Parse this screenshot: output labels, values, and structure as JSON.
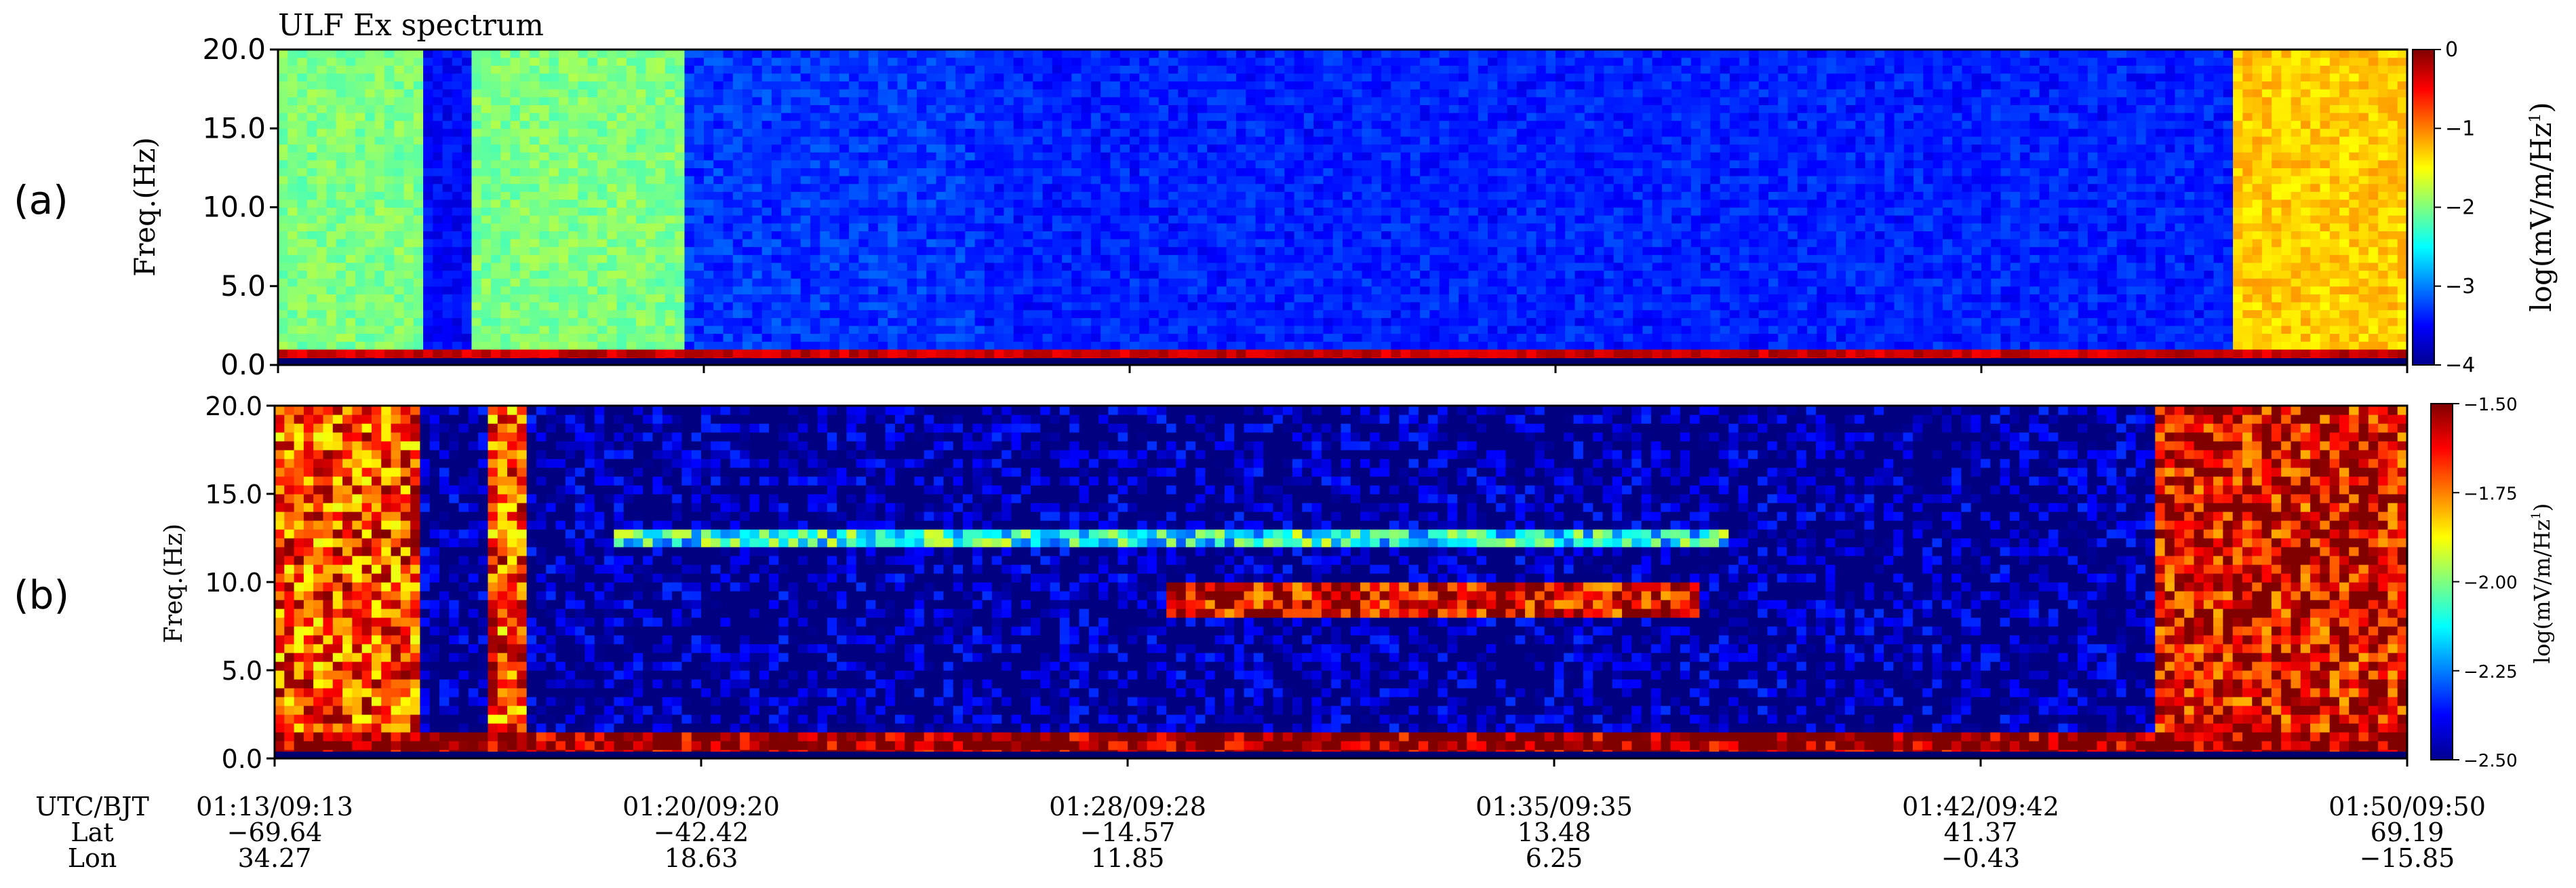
{
  "chart_data": [
    {
      "type": "heatmap",
      "panel_label": "(a)",
      "title": "ULF Ex spectrum",
      "ylabel": "Freq.(Hz)",
      "ylim": [
        0.0,
        20.0
      ],
      "yticks": [
        "0.0",
        "5.0",
        "10.0",
        "15.0",
        "20.0"
      ],
      "colorbar": {
        "label": "log(mV/m/Hz^1/2)",
        "label_main": "log(mV/m/Hz",
        "label_exp": "1",
        "label_exp_den": "2",
        "label_close": ")",
        "range": [
          -4,
          0
        ],
        "ticks": [
          "0",
          "-1",
          "-2",
          "-3",
          "-4"
        ],
        "colormap": "jet"
      },
      "features": [
        {
          "x_range": [
            0.0,
            0.07
          ],
          "f_range": [
            0,
            20
          ],
          "level": -2.0
        },
        {
          "x_range": [
            0.09,
            0.19
          ],
          "f_range": [
            0,
            20
          ],
          "level": -2.0
        },
        {
          "x_range": [
            0.19,
            0.33
          ],
          "f_range": [
            0,
            20
          ],
          "level": -3.3
        },
        {
          "x_range": [
            0.33,
            0.92
          ],
          "f_range": [
            0,
            20
          ],
          "level": -3.4
        },
        {
          "x_range": [
            0.0,
            1.0
          ],
          "f_range": [
            0,
            1.2
          ],
          "level": -0.3
        },
        {
          "x_range": [
            0.92,
            1.0
          ],
          "f_range": [
            0,
            20
          ],
          "level": -1.3
        }
      ]
    },
    {
      "type": "heatmap",
      "panel_label": "(b)",
      "title": "",
      "ylabel": "Freq.(Hz)",
      "ylim": [
        0.0,
        20.0
      ],
      "yticks": [
        "0.0",
        "5.0",
        "10.0",
        "15.0",
        "20.0"
      ],
      "colorbar": {
        "label": "log(mV/m/Hz^1/2)",
        "label_main": "log(mV/m/Hz",
        "label_exp": "1",
        "label_exp_den": "2",
        "label_close": ")",
        "range": [
          -2.5,
          -1.5
        ],
        "ticks": [
          "-1.50",
          "-1.75",
          "-2.00",
          "-2.25",
          "-2.50"
        ],
        "colormap": "jet"
      },
      "features": [
        {
          "x_range": [
            0.0,
            0.07
          ],
          "f_range": [
            0,
            20
          ],
          "level": -1.7
        },
        {
          "x_range": [
            0.1,
            0.12
          ],
          "f_range": [
            0,
            20
          ],
          "level": -1.7
        },
        {
          "x_range": [
            0.0,
            1.0
          ],
          "f_range": [
            0,
            1.5
          ],
          "level": -1.5
        },
        {
          "x_range": [
            0.16,
            0.68
          ],
          "f_range": [
            12,
            13
          ],
          "level": -2.1
        },
        {
          "x_range": [
            0.42,
            0.67
          ],
          "f_range": [
            8,
            10
          ],
          "level": -1.6
        },
        {
          "x_range": [
            0.88,
            1.0
          ],
          "f_range": [
            0,
            20
          ],
          "level": -1.6
        }
      ]
    }
  ],
  "x_axis": {
    "row_labels": [
      "UTC/BJT",
      "Lat",
      "Lon"
    ],
    "ticks": [
      {
        "time": "01:13/09:13",
        "lat": "−69.64",
        "lon": "34.27"
      },
      {
        "time": "01:20/09:20",
        "lat": "−42.42",
        "lon": "18.63"
      },
      {
        "time": "01:28/09:28",
        "lat": "−14.57",
        "lon": "11.85"
      },
      {
        "time": "01:35/09:35",
        "lat": "13.48",
        "lon": "6.25"
      },
      {
        "time": "01:42/09:42",
        "lat": "41.37",
        "lon": "−0.43"
      },
      {
        "time": "01:50/09:50",
        "lat": "69.19",
        "lon": "−15.85"
      }
    ]
  }
}
